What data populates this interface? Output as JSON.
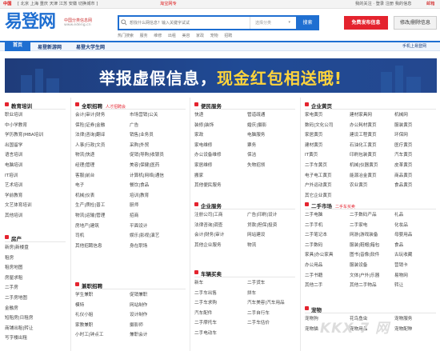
{
  "topbar": {
    "region": "中国",
    "cities": "[ 北京 上海 重庆 天津 江苏 安徽 切换城市 ]",
    "hot": "淘宝网专",
    "login": "我的关注  ·  登录  注册  我的信息",
    "mail": "邮箱"
  },
  "header": {
    "logo": "易登网",
    "logo_sub1": "中国分类信息网",
    "logo_sub2": "www.edeng.cn",
    "search_placeholder": "想找什么网信息？输入关键字试试",
    "category_select": "选择分类",
    "search_button": "搜索",
    "post_button": "免费发布信息",
    "edit_button": "修改/删除信息",
    "hot_keywords": [
      "热门搜索",
      "服务",
      "维修",
      "出租",
      "美容",
      "家政",
      "宠物",
      "招聘"
    ]
  },
  "nav": {
    "items": [
      "首页",
      "易登新游网",
      "易登大学生网"
    ],
    "mobile": "手机上易登网"
  },
  "banner": {
    "text_a": "举报虚假信息，",
    "text_b": "现金红包相送哦!"
  },
  "sections": {
    "education": {
      "title": "教育培训",
      "items": [
        "职业培训",
        "中小学教育",
        "学历教育|MBA培训",
        "出国留学",
        "语言培训",
        "电脑培训",
        "IT培训",
        "艺术培训",
        "学前教育",
        "文艺体育培训",
        "其他培训"
      ]
    },
    "house": {
      "title": "房产",
      "items": [
        "新房|新楼盘",
        "租房",
        "租房地图",
        "房屋求租",
        "二手房",
        "二手房地图",
        "金融房",
        "短租房|日租房",
        "商铺出租|转让",
        "写字楼出租"
      ]
    },
    "jobs": {
      "title": "全职招聘",
      "tag": "人才招聘会",
      "left": [
        "会计|审计|财务",
        "保险|证券|金融",
        "法律|咨询|翻译",
        "人事|行政|文员",
        "物流|快递",
        "经理|管理",
        "客服|前台",
        "电子",
        "机械|仪表",
        "生产|质检|普工",
        "物流|运输|管理",
        "房地产|建筑",
        "司机",
        "其他招聘信息"
      ],
      "right": [
        "市场营销|公关",
        "广告",
        "销售|业务员",
        "采购|外贸",
        "促销|导购|收银员",
        "美容|保健|医药",
        "计算机|网络|通信",
        "餐饮|食品",
        "培训|教育",
        "厨师",
        "招商",
        "平面设计",
        "娱乐|影视|演艺",
        "身在职场"
      ]
    },
    "parttime": {
      "title": "兼职招聘",
      "left": [
        "学生兼职",
        "模特",
        "礼仪小姐",
        "家教兼职",
        "小时工|钟点工"
      ],
      "right": [
        "促销兼职",
        "网站制作",
        "设计制作",
        "摄影师",
        "兼职会计"
      ]
    },
    "life": {
      "title": "便民服务",
      "left": [
        "快递",
        "装修|装饰",
        "家政",
        "家电维修",
        "办公设备维修",
        "家居维修",
        "搬家",
        "其他便民服务"
      ],
      "right": [
        "管道疏通",
        "婚庆|摄影",
        "电脑服务",
        "票务",
        "保洁",
        "失物招领",
        "",
        ""
      ]
    },
    "business": {
      "title": "企业服务",
      "left": [
        "注册公司|工商",
        "法律咨询|调查",
        "会计|财务|审计",
        "其他企业服务"
      ],
      "right": [
        "广告|印刷|设计",
        "贷款|担保|投资",
        "网站建设",
        "物流"
      ]
    },
    "cars": {
      "title": "车辆买卖",
      "left": [
        "新车",
        "二手车出售",
        "二手车求购",
        "汽车配件",
        "二手摩托车",
        "二手电动车"
      ],
      "right": [
        "二手货车",
        "拼车",
        "汽车美容|汽车用品",
        "二手自行车",
        "二手车估价",
        ""
      ]
    },
    "yellow": {
      "title": "企业黄页",
      "c1": [
        "家电黄页",
        "数码|文化公司",
        "家居黄页",
        "建材黄页",
        "IT黄页",
        "二手车黄页",
        "电子电工黄页",
        "户外运动黄页",
        "其它企业黄页"
      ],
      "c2": [
        "建材家具网",
        "办公耗材黄页",
        "建设工程黄页",
        "石油化工黄页",
        "印刷包装黄页",
        "机械|仪器黄页",
        "能源冶金黄页",
        "农业黄页"
      ],
      "c3": [
        "机械网",
        "服装黄页",
        "环保网",
        "医疗黄页",
        "汽车黄页",
        "皮革黄页",
        "商品黄页",
        "食品黄页"
      ]
    },
    "market": {
      "title": "二手市场",
      "tag": "二手车买卖",
      "c1": [
        "二手电脑",
        "二手手机",
        "二手笔记本",
        "二手数码",
        "家具|办公家具",
        "办公用品",
        "二手书籍",
        "其他二手"
      ],
      "c2": [
        "二手数码产品",
        "二手家电",
        "网游|游戏装备",
        "服装|鞋帽|箱包",
        "图书|音像|软件",
        "服装设备",
        "文体|户外|乐器",
        "其他二手物品"
      ],
      "c3": [
        "礼品",
        "化妆品",
        "母婴用品",
        "食品",
        "古玩收藏",
        "营销卡",
        "易物网",
        "转让"
      ]
    },
    "pets": {
      "title": "宠物",
      "c1": [
        "宠物狗",
        "宠物猫"
      ],
      "c2": [
        "花鸟鱼虫",
        "宠物用品"
      ],
      "c3": [
        "宠物服务",
        "宠物配种"
      ]
    }
  },
  "watermark": "KKX 7 网"
}
